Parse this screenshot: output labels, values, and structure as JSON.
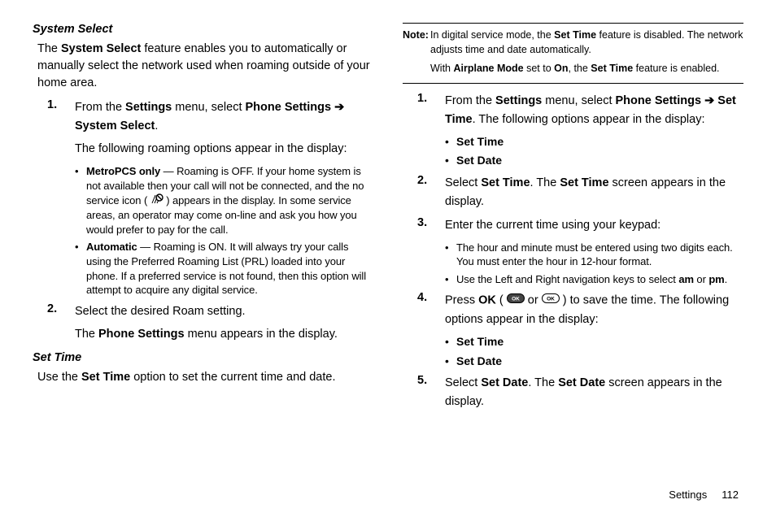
{
  "left": {
    "heading1": "System Select",
    "p1_a": "The ",
    "p1_b": "System Select",
    "p1_c": " feature enables you to automatically or manually select the network used when roaming outside of your home area.",
    "step1_num": "1.",
    "step1_a": "From the ",
    "step1_b": "Settings",
    "step1_c": " menu, select ",
    "step1_d": "Phone Settings ",
    "step1_arrow": "➔",
    "step1_e": "System Select",
    "step1_f": ".",
    "p2": "The following roaming options appear in the display:",
    "b1_label": "MetroPCS only",
    "b1_a": " — Roaming is OFF. If your home system is not available then your call will not be connected, and the no service icon ( ",
    "b1_b": " ) appears in the display. In some service areas, an operator may come on-line and ask you how you would prefer to pay for the call.",
    "b2_label": "Automatic",
    "b2_text": " — Roaming is ON. It will always try your calls using the Preferred Roaming List (PRL) loaded into your phone. If a preferred service is not found, then this option will attempt to acquire any digital service.",
    "step2_num": "2.",
    "step2_text": "Select the desired Roam setting.",
    "p3_a": "The ",
    "p3_b": "Phone Settings",
    "p3_c": " menu appears in the display.",
    "heading2": "Set Time",
    "p4_a": "Use the ",
    "p4_b": "Set Time",
    "p4_c": " option to set the current time and date."
  },
  "right": {
    "note_label": "Note:",
    "note1_a": "In digital service mode, the ",
    "note1_b": "Set Time",
    "note1_c": " feature is disabled. The network adjusts time and date automatically.",
    "note2_a": "With ",
    "note2_b": "Airplane Mode",
    "note2_c": " set to ",
    "note2_d": "On",
    "note2_e": ", the ",
    "note2_f": "Set Time",
    "note2_g": " feature is enabled.",
    "step1_num": "1.",
    "step1_a": "From the ",
    "step1_b": "Settings",
    "step1_c": " menu, select ",
    "step1_d": "Phone Settings ",
    "step1_arrow": "➔",
    "step1_e": " Set Time",
    "step1_f": ". The following options appear in the display:",
    "opt_set_time": "Set Time",
    "opt_set_date": "Set Date",
    "step2_num": "2.",
    "step2_a": "Select ",
    "step2_b": "Set Time",
    "step2_c": ". The ",
    "step2_d": "Set Time",
    "step2_e": " screen appears in the display.",
    "step3_num": "3.",
    "step3_text": "Enter the current time using your keypad:",
    "b3_text": "The hour and minute must be entered using two digits each. You must enter the hour in 12-hour format.",
    "b4_a": "Use the Left and Right navigation keys to select ",
    "b4_b": "am",
    "b4_c": " or ",
    "b4_d": "pm",
    "b4_e": ".",
    "step4_num": "4.",
    "step4_a": "Press ",
    "step4_b": "OK",
    "step4_c": " ( ",
    "step4_or": " or ",
    "step4_d": " ) to save the time. The following options appear in the display:",
    "step5_num": "5.",
    "step5_a": "Select ",
    "step5_b": "Set Date",
    "step5_c": ". The ",
    "step5_d": "Set Date",
    "step5_e": " screen appears in the display."
  },
  "footer": {
    "section": "Settings",
    "page": "112"
  }
}
